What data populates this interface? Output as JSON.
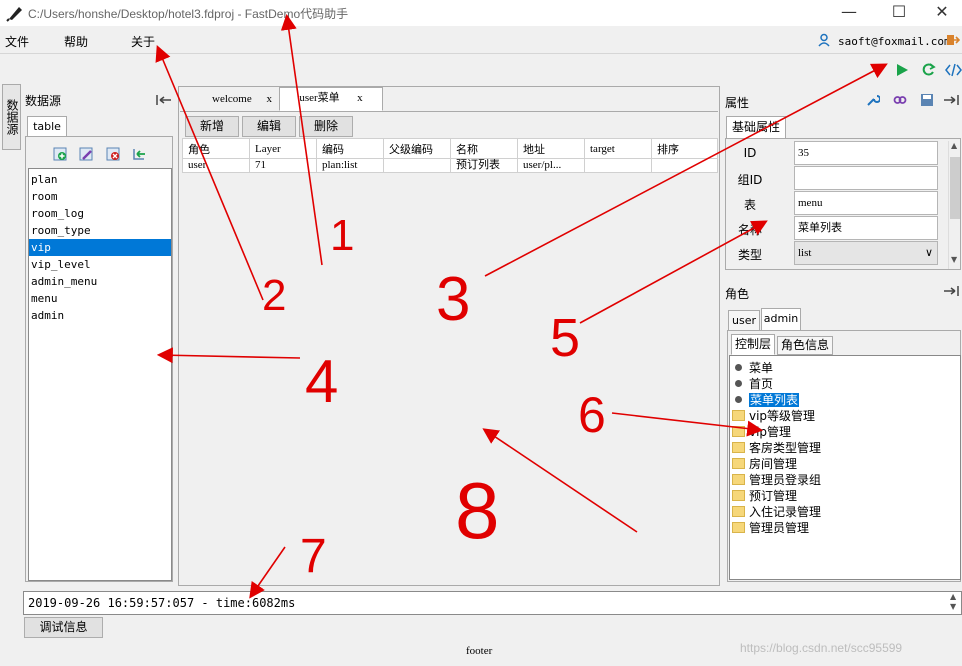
{
  "window": {
    "title": "C:/Users/honshe/Desktop/hotel3.fdproj - FastDemo代码助手"
  },
  "menu": [
    "文件",
    "帮助",
    "关于"
  ],
  "user": {
    "email": "saoft@foxmail.com"
  },
  "left_side_tab": "数据源",
  "datasource": {
    "title": "数据源",
    "tab": "table",
    "items": [
      "plan",
      "room",
      "room_log",
      "room_type",
      "vip",
      "vip_level",
      "admin_menu",
      "menu",
      "admin"
    ],
    "selected": "vip"
  },
  "editor": {
    "tabs": [
      {
        "label": "welcome",
        "close": "x"
      },
      {
        "label": "user菜单",
        "close": "x"
      }
    ],
    "buttons": [
      "新增",
      "编辑",
      "删除"
    ],
    "columns": [
      "角色",
      "Layer",
      "编码",
      "父级编码",
      "名称",
      "地址",
      "target",
      "排序"
    ],
    "rows": [
      [
        "user",
        "71",
        "plan:list",
        "",
        "预订列表",
        "user/pl...",
        "",
        ""
      ]
    ]
  },
  "properties": {
    "title": "属性",
    "tab": "基础属性",
    "fields": [
      {
        "label": "ID",
        "value": "35"
      },
      {
        "label": "组ID",
        "value": ""
      },
      {
        "label": "表",
        "value": "menu"
      },
      {
        "label": "名称",
        "value": "菜单列表"
      },
      {
        "label": "类型",
        "value": "list"
      }
    ]
  },
  "roles": {
    "title": "角色",
    "tabs": [
      "user",
      "admin"
    ],
    "subtabs": [
      "控制层",
      "角色信息"
    ],
    "tree": [
      {
        "label": "菜单",
        "kind": "dot"
      },
      {
        "label": "首页",
        "kind": "dot"
      },
      {
        "label": "菜单列表",
        "kind": "dot",
        "selected": true
      },
      {
        "label": "vip等级管理",
        "kind": "folder"
      },
      {
        "label": "vip管理",
        "kind": "folder"
      },
      {
        "label": "客房类型管理",
        "kind": "folder"
      },
      {
        "label": "房间管理",
        "kind": "folder"
      },
      {
        "label": "管理员登录组",
        "kind": "folder"
      },
      {
        "label": "预订管理",
        "kind": "folder"
      },
      {
        "label": "入住记录管理",
        "kind": "folder"
      },
      {
        "label": "管理员管理",
        "kind": "folder"
      }
    ]
  },
  "log": {
    "text": "2019-09-26 16:59:57:057 - time:6082ms"
  },
  "debug_button": "调试信息",
  "footer": {
    "text": "footer"
  },
  "watermark": "https://blog.csdn.net/scc95599",
  "annotation_numbers": [
    "1",
    "2",
    "3",
    "4",
    "5",
    "6",
    "7",
    "8"
  ],
  "colors": {
    "selection": "#0078d7",
    "annotation": "#e00000",
    "run": "#1aa34a"
  }
}
